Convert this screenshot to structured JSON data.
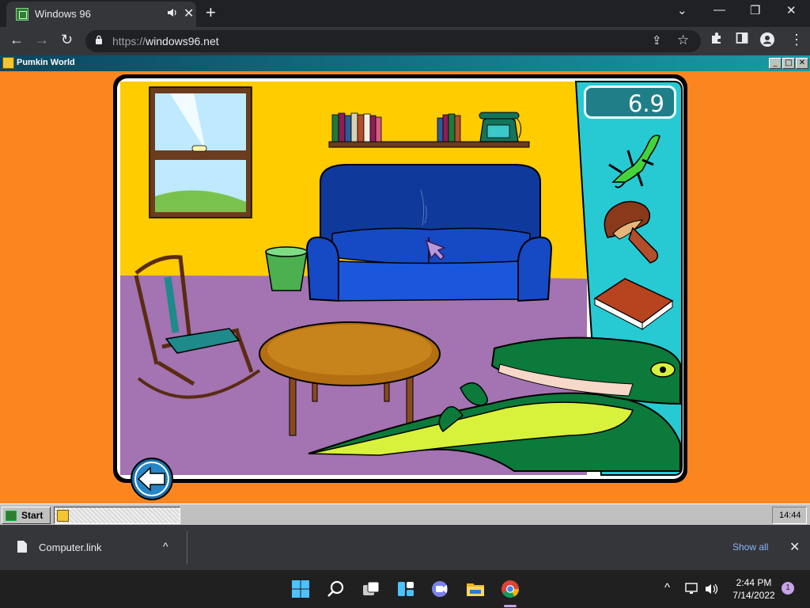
{
  "browser": {
    "tab": {
      "title": "Windows 96",
      "audio_icon": "speaker-icon",
      "close_glyph": "✕"
    },
    "new_tab_glyph": "+",
    "window_controls": {
      "minimize": "⌄",
      "maximize": "—",
      "restore": "❐",
      "close": "✕"
    },
    "toolbar": {
      "back": "←",
      "forward": "→",
      "reload": "↻"
    },
    "address_bar": {
      "scheme": "https://",
      "host": "windows96.net"
    },
    "omnibox_icons": {
      "share": "⇪",
      "bookmark": "☆"
    },
    "extensions": {
      "puzzle": "puzzle-icon",
      "sidepanel": "side-panel-icon",
      "profile": "profile-icon",
      "menu": "⋮"
    }
  },
  "win96": {
    "window_title": "Pumkin World",
    "window_buttons": {
      "minimize": "_",
      "maximize": "□",
      "close": "✕"
    },
    "start_label": "Start",
    "tray_time": "14:44"
  },
  "game": {
    "timer": "6.9",
    "inventory": [
      "lizard",
      "mushroom",
      "book"
    ],
    "back_arrow": "back-arrow-icon"
  },
  "downloads": {
    "file_name": "Computer.link",
    "caret": "^",
    "show_all": "Show all",
    "close": "✕"
  },
  "os": {
    "time": "2:44 PM",
    "date": "7/14/2022",
    "notification_count": "1",
    "tray_up": "^"
  }
}
